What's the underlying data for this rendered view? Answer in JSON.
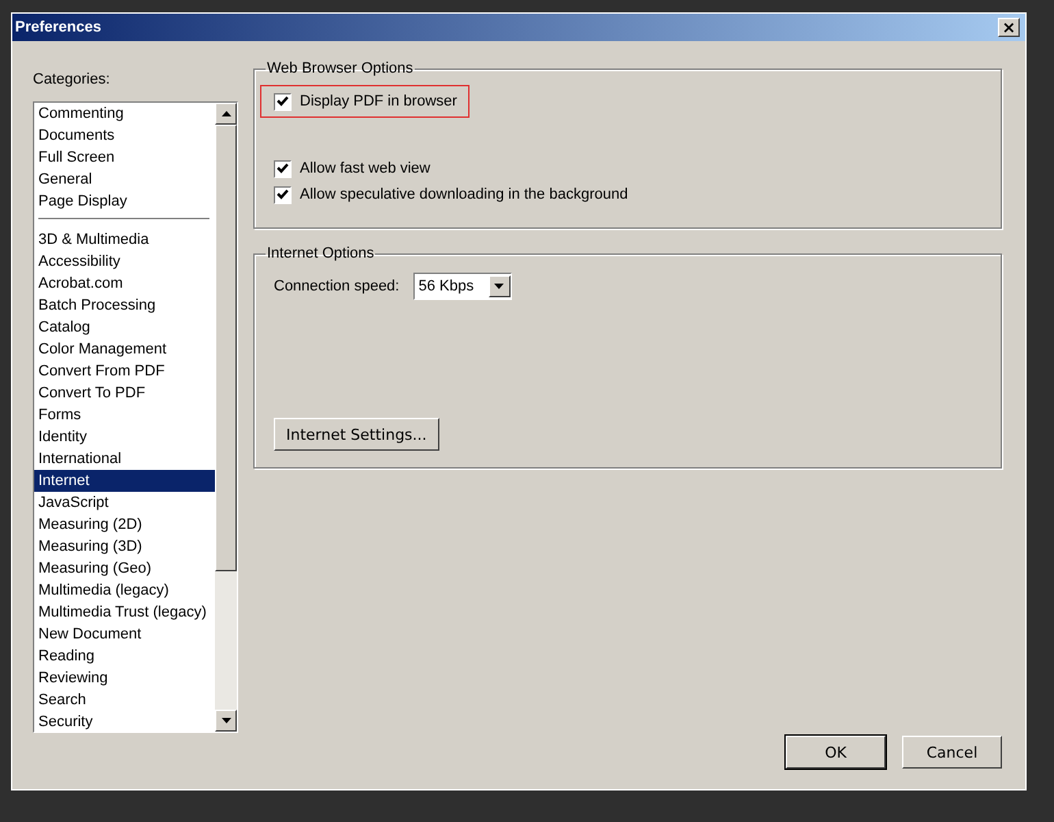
{
  "window": {
    "title": "Preferences",
    "close": "×"
  },
  "categories": {
    "label": "Categories:",
    "items": [
      {
        "kind": "item",
        "label": "Commenting",
        "selected": false
      },
      {
        "kind": "item",
        "label": "Documents",
        "selected": false
      },
      {
        "kind": "item",
        "label": "Full Screen",
        "selected": false
      },
      {
        "kind": "item",
        "label": "General",
        "selected": false
      },
      {
        "kind": "item",
        "label": "Page Display",
        "selected": false
      },
      {
        "kind": "separator"
      },
      {
        "kind": "item",
        "label": "3D & Multimedia",
        "selected": false
      },
      {
        "kind": "item",
        "label": "Accessibility",
        "selected": false
      },
      {
        "kind": "item",
        "label": "Acrobat.com",
        "selected": false
      },
      {
        "kind": "item",
        "label": "Batch Processing",
        "selected": false
      },
      {
        "kind": "item",
        "label": "Catalog",
        "selected": false
      },
      {
        "kind": "item",
        "label": "Color Management",
        "selected": false
      },
      {
        "kind": "item",
        "label": "Convert From PDF",
        "selected": false
      },
      {
        "kind": "item",
        "label": "Convert To PDF",
        "selected": false
      },
      {
        "kind": "item",
        "label": "Forms",
        "selected": false
      },
      {
        "kind": "item",
        "label": "Identity",
        "selected": false
      },
      {
        "kind": "item",
        "label": "International",
        "selected": false
      },
      {
        "kind": "item",
        "label": "Internet",
        "selected": true
      },
      {
        "kind": "item",
        "label": "JavaScript",
        "selected": false
      },
      {
        "kind": "item",
        "label": "Measuring (2D)",
        "selected": false
      },
      {
        "kind": "item",
        "label": "Measuring (3D)",
        "selected": false
      },
      {
        "kind": "item",
        "label": "Measuring (Geo)",
        "selected": false
      },
      {
        "kind": "item",
        "label": "Multimedia (legacy)",
        "selected": false
      },
      {
        "kind": "item",
        "label": "Multimedia Trust (legacy)",
        "selected": false
      },
      {
        "kind": "item",
        "label": "New Document",
        "selected": false
      },
      {
        "kind": "item",
        "label": "Reading",
        "selected": false
      },
      {
        "kind": "item",
        "label": "Reviewing",
        "selected": false
      },
      {
        "kind": "item",
        "label": "Search",
        "selected": false
      },
      {
        "kind": "item",
        "label": "Security",
        "selected": false
      }
    ]
  },
  "web_browser_options": {
    "title": "Web Browser Options",
    "options": [
      {
        "label": "Display PDF in browser",
        "checked": true,
        "highlighted": true
      },
      {
        "label": "Allow fast web view",
        "checked": true,
        "highlighted": false
      },
      {
        "label": "Allow speculative downloading in the background",
        "checked": true,
        "highlighted": false
      }
    ]
  },
  "internet_options": {
    "title": "Internet Options",
    "connection_speed": {
      "label": "Connection speed:",
      "value": "56 Kbps"
    },
    "settings_button": "Internet Settings..."
  },
  "buttons": [
    {
      "label": "OK",
      "default": true
    },
    {
      "label": "Cancel",
      "default": false
    }
  ]
}
